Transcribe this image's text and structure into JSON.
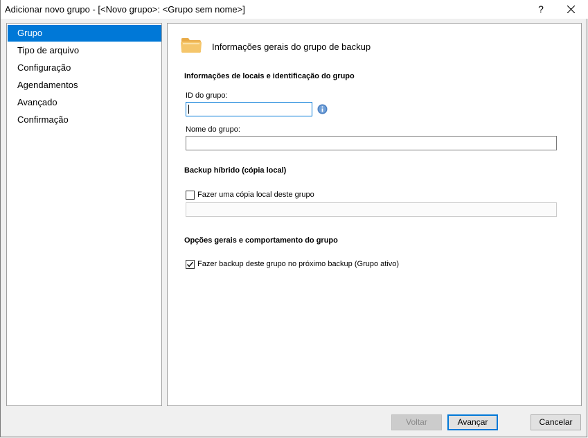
{
  "window": {
    "title": "Adicionar novo grupo - [<Novo grupo>: <Grupo sem nome>]",
    "help_label": "?"
  },
  "sidebar": {
    "items": [
      {
        "label": "Grupo",
        "active": true
      },
      {
        "label": "Tipo de arquivo",
        "active": false
      },
      {
        "label": "Configuração",
        "active": false
      },
      {
        "label": "Agendamentos",
        "active": false
      },
      {
        "label": "Avançado",
        "active": false
      },
      {
        "label": "Confirmação",
        "active": false
      }
    ]
  },
  "content": {
    "header_title": "Informações gerais do grupo de backup",
    "section_location": "Informações de locais e identificação do grupo",
    "group_id_label": "ID do grupo:",
    "group_id_value": "",
    "group_name_label": "Nome do grupo:",
    "group_name_value": "",
    "section_hybrid": "Backup híbrido (cópia local)",
    "local_copy_label": "Fazer uma cópia local deste grupo",
    "local_copy_checked": false,
    "local_copy_path": "",
    "section_options": "Opções gerais e comportamento do grupo",
    "active_group_label": "Fazer backup deste grupo no próximo backup (Grupo ativo)",
    "active_group_checked": true
  },
  "buttons": {
    "back": "Voltar",
    "next": "Avançar",
    "cancel": "Cancelar"
  },
  "colors": {
    "accent": "#0078d7",
    "folder": "#f5c66b"
  },
  "icons": {
    "header": "folder-icon",
    "info": "info-icon",
    "close": "close-icon"
  }
}
